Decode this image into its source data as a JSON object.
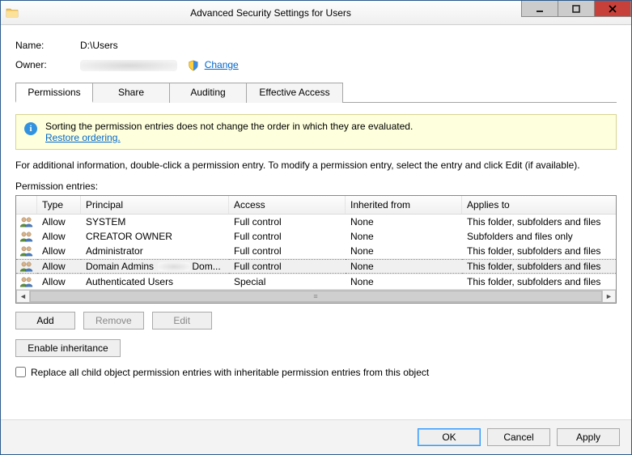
{
  "window": {
    "title": "Advanced Security Settings for Users"
  },
  "header": {
    "name_label": "Name:",
    "name_value": "D:\\Users",
    "owner_label": "Owner:",
    "change_link": "Change"
  },
  "tabs": [
    {
      "id": "permissions",
      "label": "Permissions",
      "active": true
    },
    {
      "id": "share",
      "label": "Share",
      "active": false
    },
    {
      "id": "auditing",
      "label": "Auditing",
      "active": false
    },
    {
      "id": "effective",
      "label": "Effective Access",
      "active": false
    }
  ],
  "banner": {
    "text": "Sorting the permission entries does not change the order in which they are evaluated.",
    "link": "Restore ordering."
  },
  "helptext": "For additional information, double-click a permission entry. To modify a permission entry, select the entry and click Edit (if available).",
  "section_label": "Permission entries:",
  "columns": {
    "type": "Type",
    "principal": "Principal",
    "access": "Access",
    "inherited": "Inherited from",
    "applies": "Applies to"
  },
  "entries": [
    {
      "type": "Allow",
      "principal": "SYSTEM",
      "access": "Full control",
      "inherited": "None",
      "applies": "This folder, subfolders and files",
      "selected": false
    },
    {
      "type": "Allow",
      "principal": "CREATOR OWNER",
      "access": "Full control",
      "inherited": "None",
      "applies": "Subfolders and files only",
      "selected": false
    },
    {
      "type": "Allow",
      "principal": "Administrator",
      "access": "Full control",
      "inherited": "None",
      "applies": "This folder, subfolders and files",
      "selected": false
    },
    {
      "type": "Allow",
      "principal": "Domain Admins",
      "principal_suffix": "Dom...",
      "access": "Full control",
      "inherited": "None",
      "applies": "This folder, subfolders and files",
      "selected": true,
      "redacted": true
    },
    {
      "type": "Allow",
      "principal": "Authenticated Users",
      "access": "Special",
      "inherited": "None",
      "applies": "This folder, subfolders and files",
      "selected": false
    }
  ],
  "buttons": {
    "add": "Add",
    "remove": "Remove",
    "edit": "Edit",
    "enable_inheritance": "Enable inheritance",
    "replace_checkbox": "Replace all child object permission entries with inheritable permission entries from this object",
    "ok": "OK",
    "cancel": "Cancel",
    "apply": "Apply"
  }
}
